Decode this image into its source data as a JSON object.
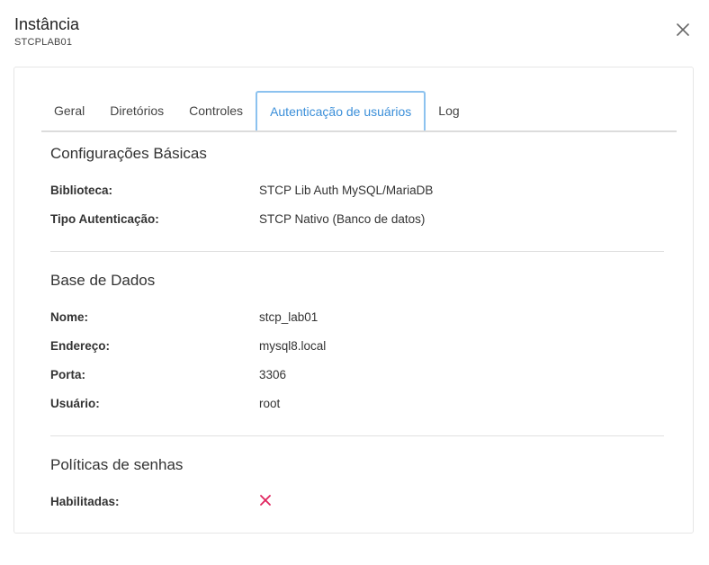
{
  "header": {
    "title": "Instância",
    "subtitle": "STCPLAB01"
  },
  "tabs": [
    {
      "label": "Geral",
      "active": false
    },
    {
      "label": "Diretórios",
      "active": false
    },
    {
      "label": "Controles",
      "active": false
    },
    {
      "label": "Autenticação de usuários",
      "active": true
    },
    {
      "label": "Log",
      "active": false
    }
  ],
  "sections": {
    "basic": {
      "title": "Configurações Básicas",
      "rows": [
        {
          "label": "Biblioteca:",
          "value": "STCP Lib Auth MySQL/MariaDB"
        },
        {
          "label": "Tipo Autenticação:",
          "value": "STCP Nativo (Banco de datos)"
        }
      ]
    },
    "database": {
      "title": "Base de Dados",
      "rows": [
        {
          "label": "Nome:",
          "value": "stcp_lab01"
        },
        {
          "label": "Endereço:",
          "value": "mysql8.local"
        },
        {
          "label": "Porta:",
          "value": "3306"
        },
        {
          "label": "Usuário:",
          "value": "root"
        }
      ]
    },
    "password": {
      "title": "Políticas de senhas",
      "rows": [
        {
          "label": "Habilitadas:",
          "icon": "x-mark-icon",
          "enabled": false
        }
      ]
    }
  },
  "colors": {
    "accent": "#3b8fd9",
    "active_tab_border": "#8cc2ef",
    "disabled_mark": "#e0245e"
  }
}
